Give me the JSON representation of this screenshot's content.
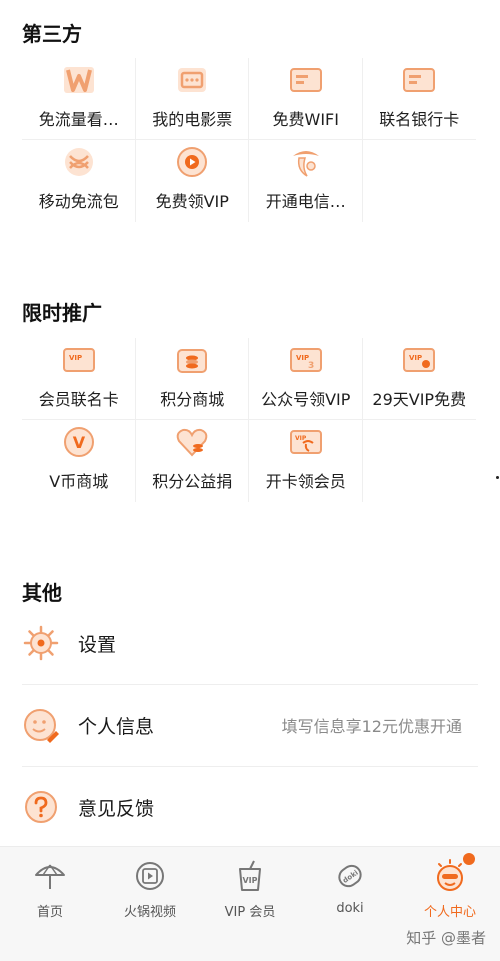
{
  "sections": {
    "third_party": {
      "title": "第三方",
      "items": [
        {
          "label": "免流量看…",
          "icon": "w-logo-icon"
        },
        {
          "label": "我的电影票",
          "icon": "ticket-icon"
        },
        {
          "label": "免费WIFI",
          "icon": "card-icon"
        },
        {
          "label": "联名银行卡",
          "icon": "bank-card-icon"
        },
        {
          "label": "移动免流包",
          "icon": "china-mobile-icon"
        },
        {
          "label": "免费领VIP",
          "icon": "video-play-icon"
        },
        {
          "label": "开通电信…",
          "icon": "china-telecom-icon"
        }
      ]
    },
    "promo": {
      "title": "限时推广",
      "items": [
        {
          "label": "会员联名卡",
          "icon": "vip-card-icon",
          "icon_text": "VIP"
        },
        {
          "label": "积分商城",
          "icon": "points-mall-icon"
        },
        {
          "label": "公众号领VIP",
          "icon": "vip-3-icon",
          "icon_text": "VIP"
        },
        {
          "label": "29天VIP免费",
          "icon": "vip-month-icon",
          "icon_text": "VIP"
        },
        {
          "label": "V币商城",
          "icon": "v-coin-icon",
          "icon_text": "V"
        },
        {
          "label": "积分公益捐",
          "icon": "heart-coins-icon"
        },
        {
          "label": "开卡领会员",
          "icon": "vip-telecom-card-icon",
          "icon_text": "VIP"
        }
      ]
    },
    "other": {
      "title": "其他",
      "items": [
        {
          "label": "设置",
          "icon": "gear-icon",
          "hint": ""
        },
        {
          "label": "个人信息",
          "icon": "smile-edit-icon",
          "hint": "填写信息享12元优惠开通"
        },
        {
          "label": "意见反馈",
          "icon": "question-icon",
          "hint": ""
        }
      ]
    }
  },
  "tabbar": [
    {
      "label": "首页",
      "icon": "umbrella-icon",
      "active": false
    },
    {
      "label": "火锅视频",
      "icon": "film-reel-icon",
      "active": false
    },
    {
      "label": "VIP 会员",
      "icon": "vip-cup-icon",
      "active": false
    },
    {
      "label": "doki",
      "icon": "doki-tag-icon",
      "active": false
    },
    {
      "label": "个人中心",
      "icon": "profile-face-icon",
      "active": true
    }
  ],
  "watermark": "知乎 @墨者",
  "colors": {
    "accent": "#f06a1e",
    "icon_orange": "#f0a070",
    "icon_light": "#fde3d2"
  }
}
